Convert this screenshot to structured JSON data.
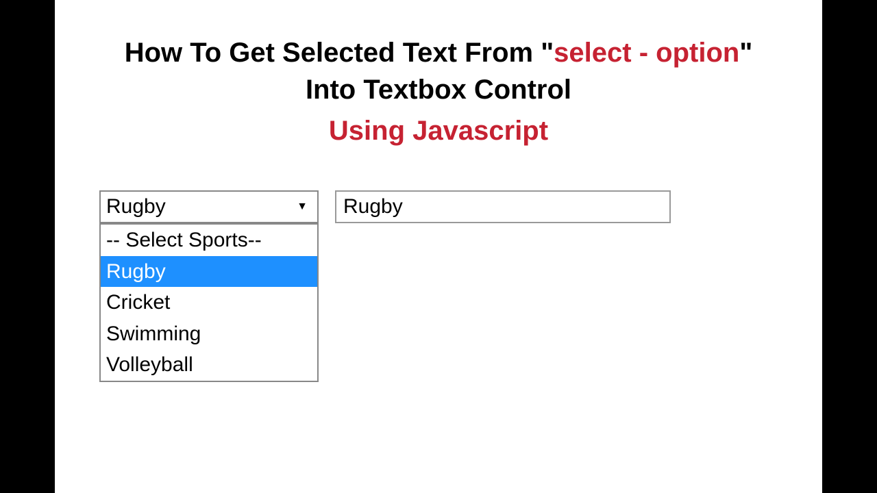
{
  "title": {
    "line1_prefix": "How To Get Selected Text From \"",
    "line1_highlight": "select - option",
    "line1_suffix": "\"",
    "line2": "Into Textbox Control",
    "line3": "Using Javascript"
  },
  "select": {
    "value": "Rugby",
    "options": [
      {
        "label": "-- Select Sports--",
        "highlighted": false
      },
      {
        "label": "Rugby",
        "highlighted": true
      },
      {
        "label": "Cricket",
        "highlighted": false
      },
      {
        "label": "Swimming",
        "highlighted": false
      },
      {
        "label": "Volleyball",
        "highlighted": false
      }
    ]
  },
  "textbox": {
    "value": "Rugby"
  },
  "colors": {
    "accent": "#c62232",
    "highlight_bg": "#1e90ff",
    "border": "#888888"
  }
}
